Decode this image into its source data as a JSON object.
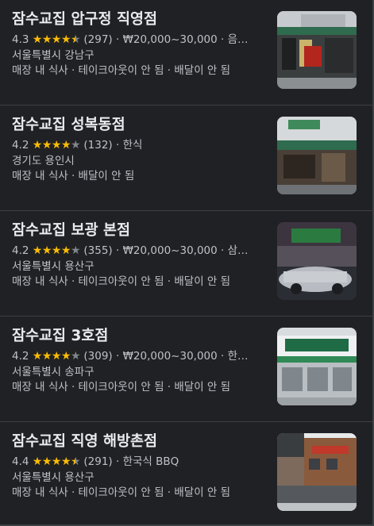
{
  "results": [
    {
      "name": "잠수교집 압구정 직영점",
      "rating": "4.3",
      "stars": 4.5,
      "reviews": "(297)",
      "detail": "₩20,000~30,000 · 음…",
      "address": "서울특별시 강남구",
      "services": "매장 내 식사 · 테이크아웃이 안 됨 · 배달이 안 됨"
    },
    {
      "name": "잠수교집 성복동점",
      "rating": "4.2",
      "stars": 4,
      "reviews": "(132)",
      "detail": "한식",
      "address": "경기도 용인시",
      "services": "매장 내 식사 · 배달이 안 됨"
    },
    {
      "name": "잠수교집 보광 본점",
      "rating": "4.2",
      "stars": 4,
      "reviews": "(355)",
      "detail": "₩20,000~30,000 · 삼…",
      "address": "서울특별시 용산구",
      "services": "매장 내 식사 · 테이크아웃이 안 됨 · 배달이 안 됨"
    },
    {
      "name": "잠수교집 3호점",
      "rating": "4.2",
      "stars": 4,
      "reviews": "(309)",
      "detail": "₩20,000~30,000 · 한…",
      "address": "서울특별시 송파구",
      "services": "매장 내 식사 · 테이크아웃이 안 됨 · 배달이 안 됨"
    },
    {
      "name": "잠수교집 직영 해방촌점",
      "rating": "4.4",
      "stars": 4.5,
      "reviews": "(291)",
      "detail": "한국식 BBQ",
      "address": "서울특별시 용산구",
      "services": "매장 내 식사 · 테이크아웃이 안 됨 · 배달이 안 됨"
    }
  ],
  "separator": " · ",
  "colors": {
    "background": "#202124",
    "star": "#fbbc04",
    "star_empty": "#80868b",
    "title": "#e8eaed",
    "text": "#bdc1c6",
    "divider": "#3c4043"
  },
  "icons": [
    "star-icon",
    "half-star-icon",
    "empty-star-icon"
  ]
}
